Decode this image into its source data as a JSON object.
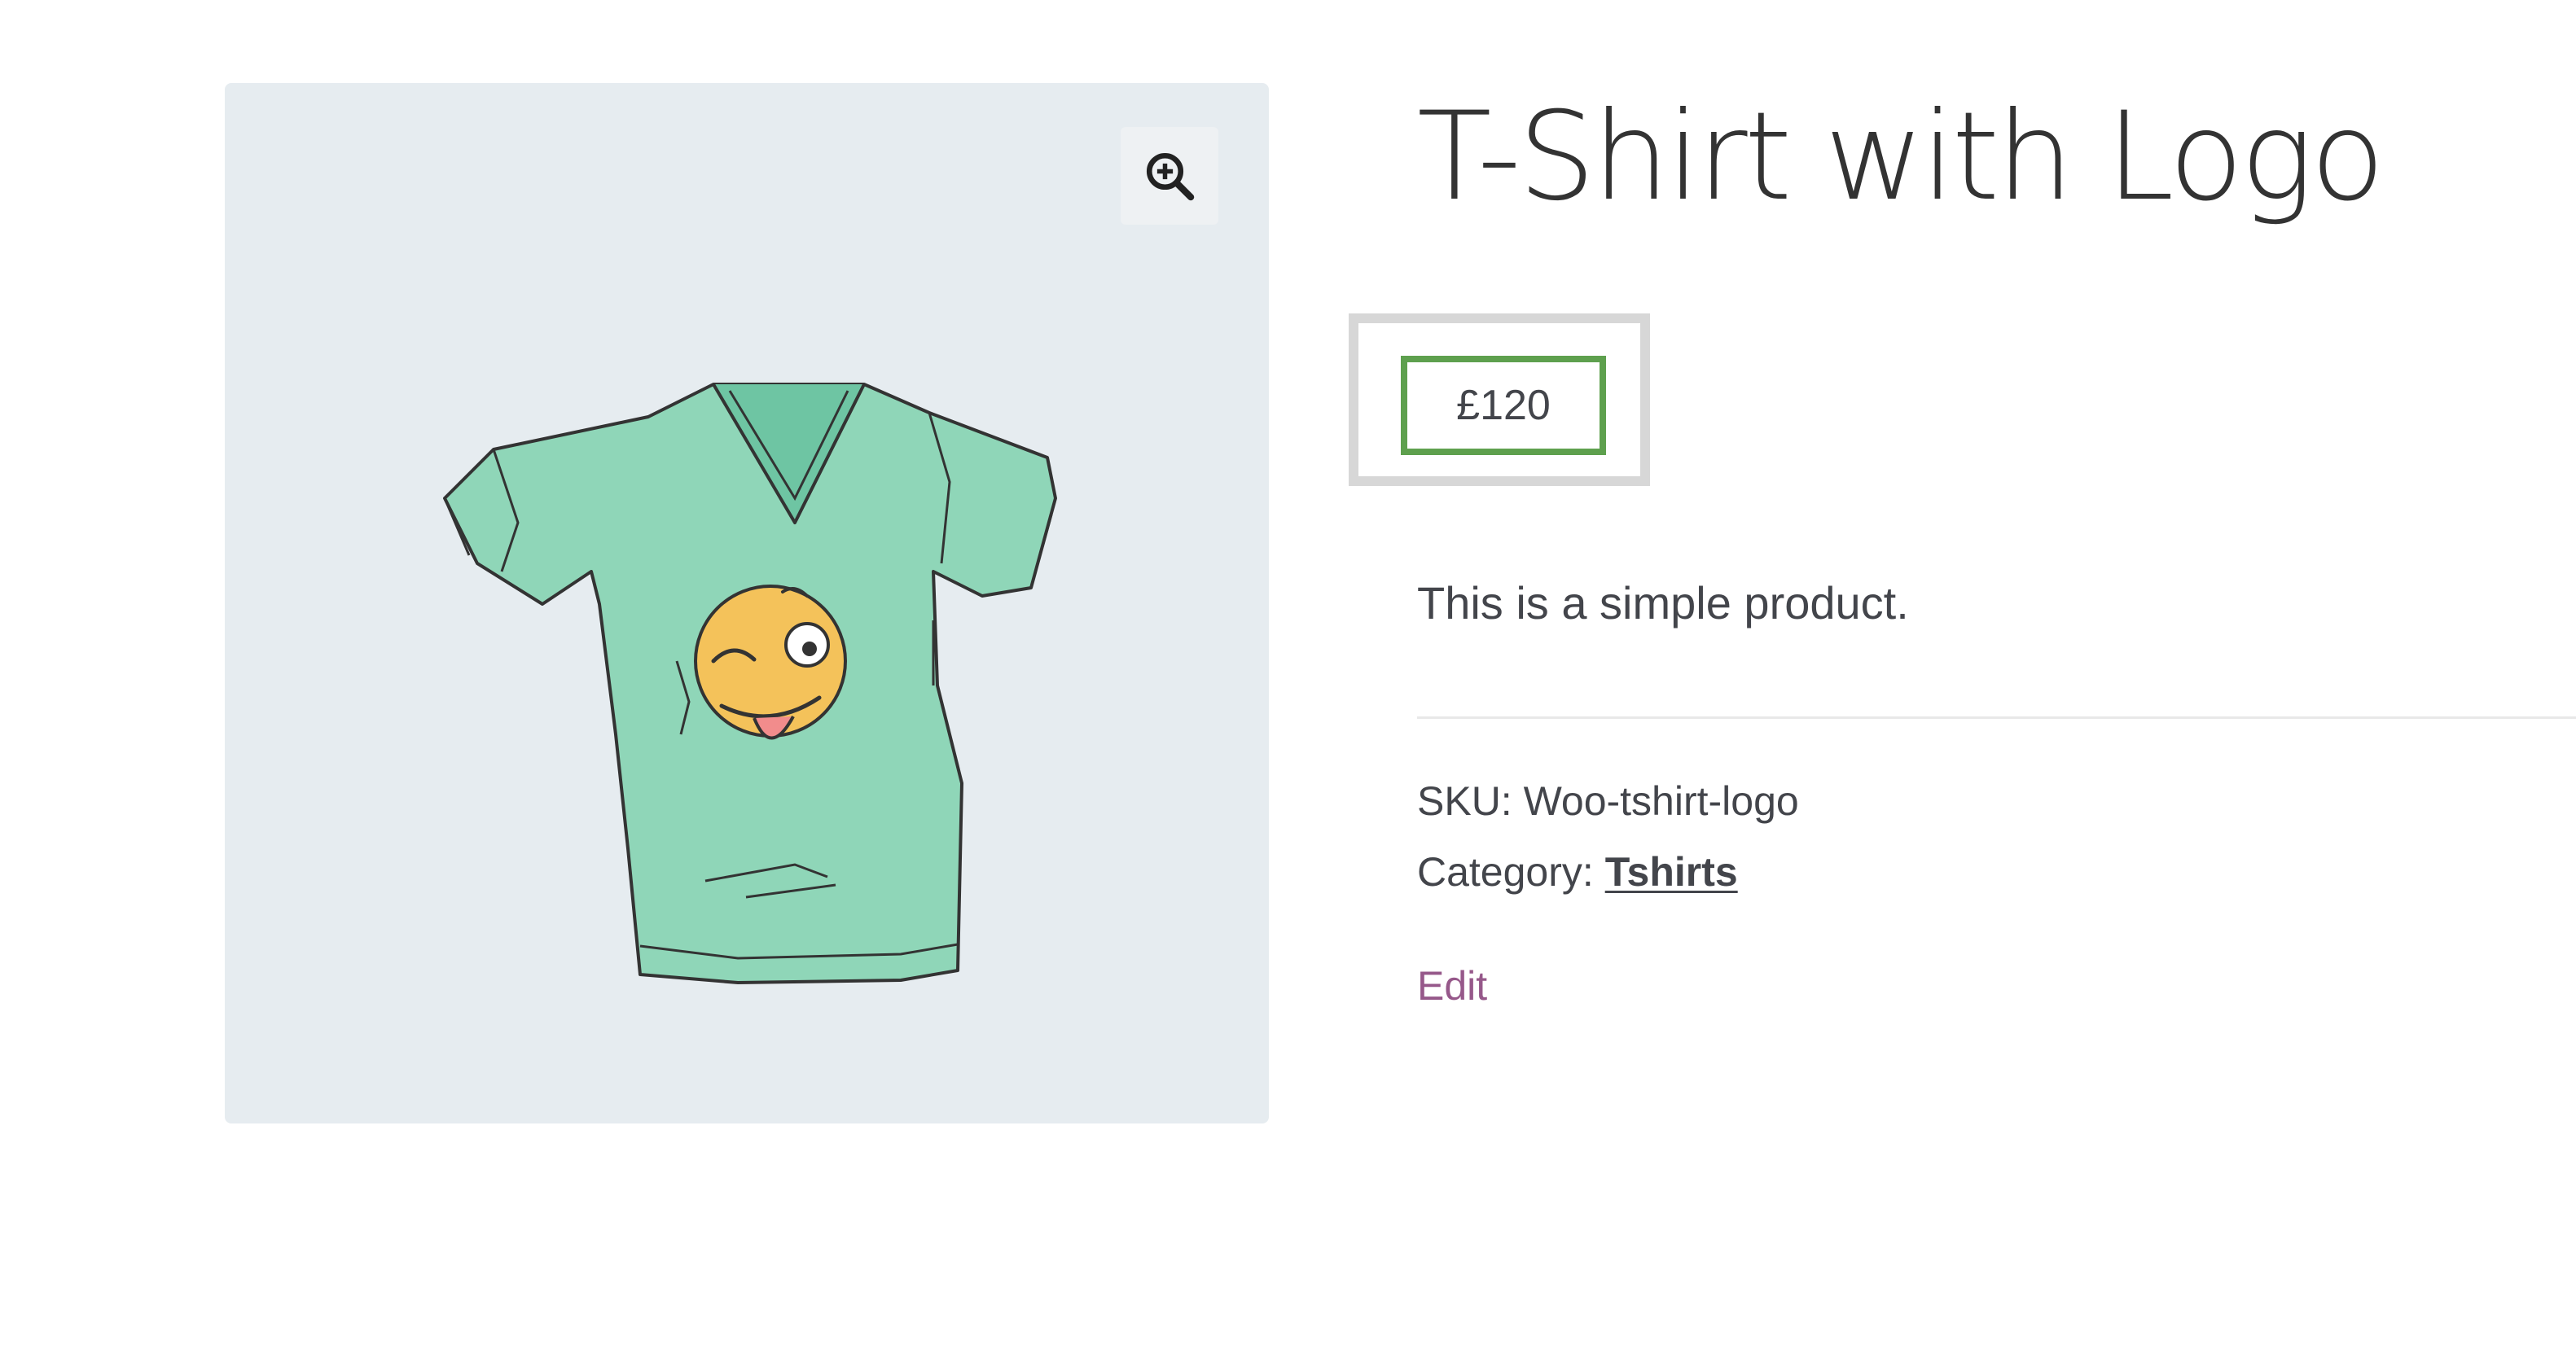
{
  "product": {
    "title": "T-Shirt with Logo",
    "price": "£120",
    "description": "This is a simple product.",
    "sku_label": "SKU:",
    "sku_value": "Woo-tshirt-logo",
    "category_label": "Category:",
    "category_value": "Tshirts",
    "edit_label": "Edit"
  },
  "icons": {
    "zoom": "zoom-in-icon"
  },
  "colors": {
    "highlight_border": "#5ea04e",
    "highlight_outer": "#d7d7d7",
    "edit_link": "#96588a",
    "gallery_bg": "#e6ecf0"
  }
}
